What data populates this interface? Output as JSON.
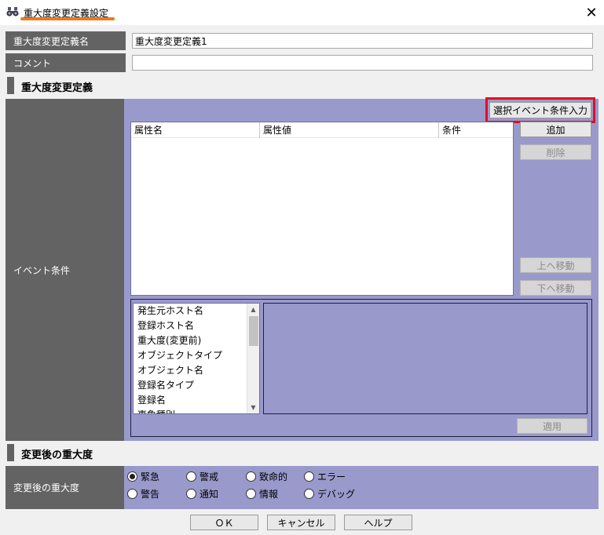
{
  "window": {
    "title": "重大度変更定義設定",
    "close_symbol": "✕"
  },
  "form": {
    "name_label": "重大度変更定義名",
    "name_value": "重大度変更定義1",
    "comment_label": "コメント",
    "comment_value": ""
  },
  "definition": {
    "section_title": "重大度変更定義",
    "event_condition_label": "イベント条件",
    "select_event_button": "選択イベント条件入力",
    "table_headers": [
      "属性名",
      "属性値",
      "条件"
    ],
    "add_button": "追加",
    "delete_button": "削除",
    "move_up_button": "上へ移動",
    "move_down_button": "下へ移動",
    "attribute_list": [
      "発生元ホスト名",
      "登録ホスト名",
      "重大度(変更前)",
      "オブジェクトタイプ",
      "オブジェクト名",
      "登録名タイプ",
      "登録名",
      "事象種別"
    ],
    "apply_button": "適用"
  },
  "severity": {
    "section_title": "変更後の重大度",
    "label": "変更後の重大度",
    "options": [
      "緊急",
      "警戒",
      "致命的",
      "エラー",
      "警告",
      "通知",
      "情報",
      "デバッグ"
    ],
    "selected": "緊急"
  },
  "footer": {
    "ok_button": "ＯＫ",
    "cancel_button": "キャンセル",
    "help_button": "ヘルプ"
  },
  "colors": {
    "label_bg": "#636363",
    "panel_bg": "#9999cc",
    "highlight": "#e01020",
    "title_underline": "#f07820"
  },
  "icons": {
    "app": "binoculars-icon",
    "scroll_up": "chevron-up-icon",
    "scroll_down": "chevron-down-icon"
  }
}
